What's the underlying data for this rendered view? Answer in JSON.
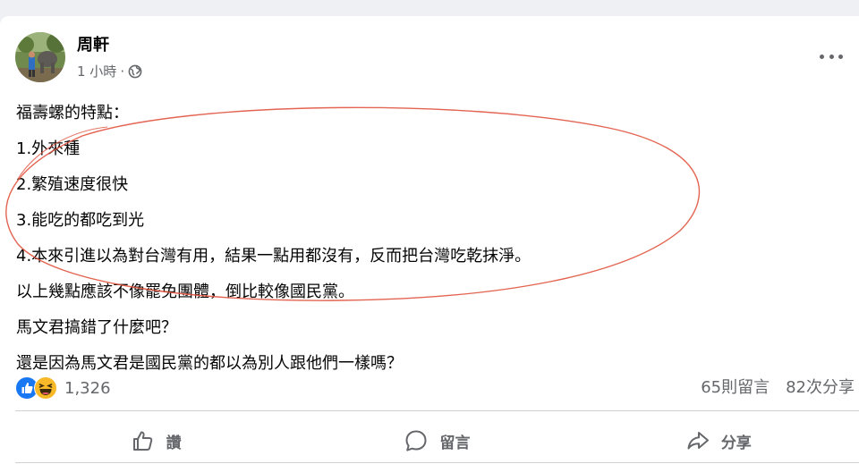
{
  "post": {
    "author": "周軒",
    "time": "1 小時",
    "separator": "·",
    "audience_icon": "globe-icon",
    "more_icon": "more-options-icon",
    "lines": [
      "福壽螺的特點：",
      "1.外來種",
      "2.繁殖速度很快",
      "3.能吃的都吃到光",
      "4.本來引進以為對台灣有用，結果一點用都沒有，反而把台灣吃乾抹淨。",
      "以上幾點應該不像罷免團體，倒比較像國民黨。",
      "馬文君搞錯了什麼吧？",
      "還是因為馬文君是國民黨的都以為別人跟他們一樣嗎？"
    ]
  },
  "reactions": {
    "icons": [
      "like-reaction-icon",
      "haha-reaction-icon"
    ],
    "count": "1,326"
  },
  "stats": {
    "comments": "65則留言",
    "shares": "82次分享"
  },
  "actions": {
    "like": "讚",
    "comment": "留言",
    "share": "分享"
  },
  "colors": {
    "background": "#eef0f3",
    "card": "#ffffff",
    "secondary_text": "#65676b",
    "like_blue": "#1877f2",
    "haha_yellow": "#f7b928",
    "annotation_red": "#e0533e",
    "divider": "#ced0d4"
  }
}
